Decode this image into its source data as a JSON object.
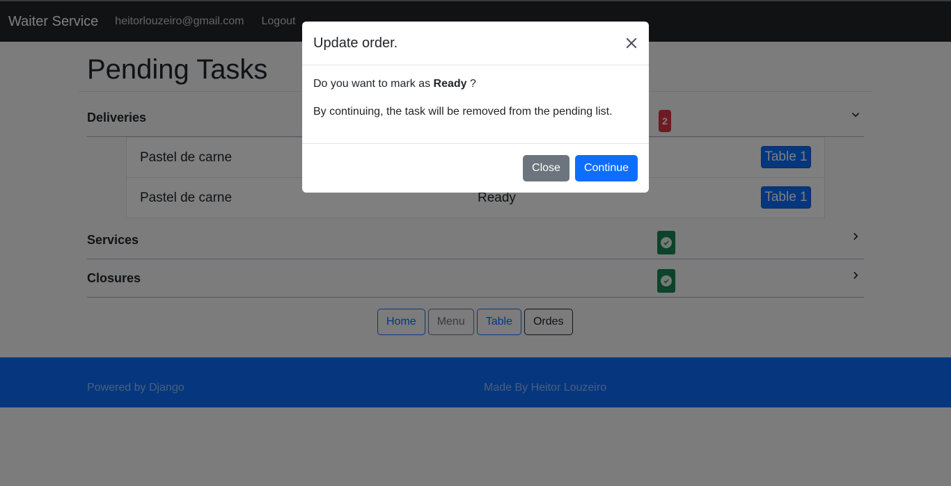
{
  "navbar": {
    "brand": "Waiter Service",
    "email": "heitorlouzeiro@gmail.com",
    "logout": "Logout"
  },
  "page": {
    "title": "Pending Tasks"
  },
  "sections": {
    "deliveries": {
      "title": "Deliveries",
      "badge": "2",
      "expanded": true
    },
    "services": {
      "title": "Services",
      "status": "check"
    },
    "closures": {
      "title": "Closures",
      "status": "check"
    }
  },
  "deliveries": [
    {
      "name": "Pastel de carne",
      "status": "",
      "table": "Table 1"
    },
    {
      "name": "Pastel de carne",
      "status": "Ready",
      "table": "Table 1"
    }
  ],
  "bottom_nav": {
    "home": "Home",
    "menu": "Menu",
    "table": "Table",
    "orders": "Ordes"
  },
  "footer": {
    "left": "Powered by Django",
    "right": "Made By Heitor Louzeiro"
  },
  "modal": {
    "title": "Update order.",
    "question_prefix": "Do you want to mark as",
    "question_status": "Ready",
    "question_suffix": "?",
    "note": "By continuing, the task will be removed from the pending list.",
    "close_label": "Close",
    "continue_label": "Continue"
  },
  "colors": {
    "primary": "#0d6efd",
    "danger": "#dc3545",
    "success": "#198754",
    "secondary": "#6c757d",
    "navbar": "#212529"
  }
}
